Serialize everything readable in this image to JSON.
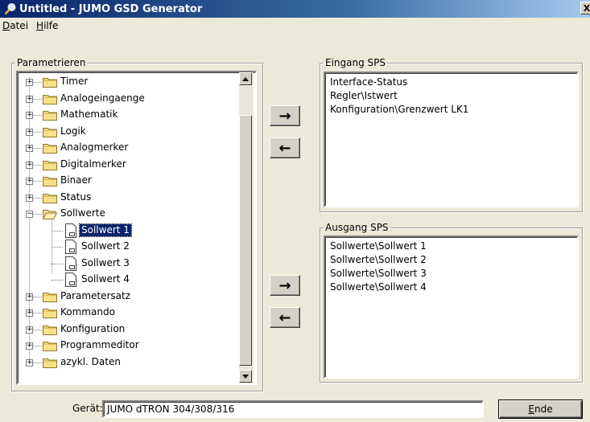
{
  "window": {
    "title": "Untitled - JUMO GSD Generator",
    "close_label": "X"
  },
  "menu": {
    "items": [
      {
        "first": "D",
        "rest": "atei"
      },
      {
        "first": "H",
        "rest": "ilfe"
      }
    ]
  },
  "parametrieren": {
    "legend": "Parametrieren",
    "tree": [
      {
        "label": "Timer",
        "type": "folder",
        "expander": "+"
      },
      {
        "label": "Analogeingaenge",
        "type": "folder",
        "expander": "+"
      },
      {
        "label": "Mathematik",
        "type": "folder",
        "expander": "+"
      },
      {
        "label": "Logik",
        "type": "folder",
        "expander": "+"
      },
      {
        "label": "Analogmerker",
        "type": "folder",
        "expander": "+"
      },
      {
        "label": "Digitalmerker",
        "type": "folder",
        "expander": "+"
      },
      {
        "label": "Binaer",
        "type": "folder",
        "expander": "+"
      },
      {
        "label": "Status",
        "type": "folder",
        "expander": "+"
      },
      {
        "label": "Sollwerte",
        "type": "folder-open",
        "expander": "−"
      },
      {
        "label": "Sollwert 1",
        "type": "doc",
        "selected": true
      },
      {
        "label": "Sollwert 2",
        "type": "doc"
      },
      {
        "label": "Sollwert 3",
        "type": "doc"
      },
      {
        "label": "Sollwert 4",
        "type": "doc"
      },
      {
        "label": "Parametersatz",
        "type": "folder",
        "expander": "+"
      },
      {
        "label": "Kommando",
        "type": "folder",
        "expander": "+"
      },
      {
        "label": "Konfiguration",
        "type": "folder",
        "expander": "+"
      },
      {
        "label": "Programmeditor",
        "type": "folder",
        "expander": "+"
      },
      {
        "label": "azykl. Daten",
        "type": "folder",
        "expander": "+"
      }
    ]
  },
  "buttons": {
    "add_arrow": "→",
    "remove_arrow": "←"
  },
  "eingang": {
    "legend": "Eingang SPS",
    "items": [
      "Interface-Status",
      "Regler\\Istwert",
      "Konfiguration\\Grenzwert LK1"
    ]
  },
  "ausgang": {
    "legend": "Ausgang SPS",
    "items": [
      "Sollwerte\\Sollwert 1",
      "Sollwerte\\Sollwert 2",
      "Sollwerte\\Sollwert 3",
      "Sollwerte\\Sollwert 4"
    ]
  },
  "footer": {
    "geraet_label": "Gerät:",
    "geraet_value": "JUMO dTRON 304/308/316",
    "ende_first": "E",
    "ende_rest": "nde"
  },
  "colors": {
    "title_start": "#0a246a",
    "selection": "#0a246a",
    "window_bg": "#ece9d8"
  }
}
